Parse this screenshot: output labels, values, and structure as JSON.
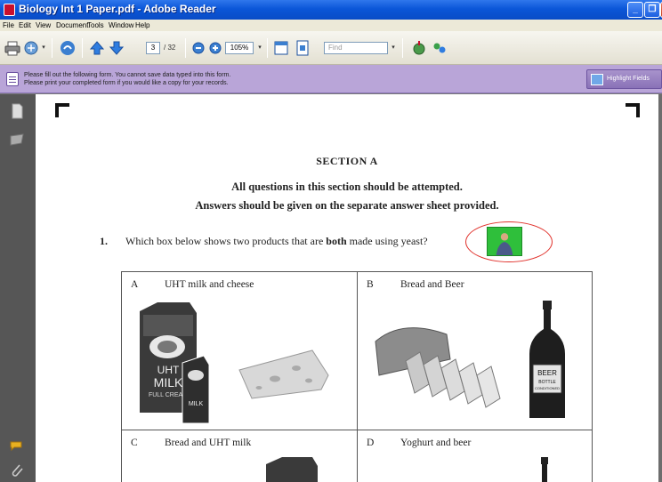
{
  "window": {
    "title": "Biology Int 1 Paper.pdf - Adobe Reader",
    "controls": [
      "minimize",
      "maximize",
      "close"
    ]
  },
  "menu": [
    "File",
    "Edit",
    "View",
    "Document",
    "Tools",
    "Window",
    "Help"
  ],
  "toolbar": {
    "current_page": "3",
    "total_pages": "/ 32",
    "zoom": "105%",
    "find_placeholder": "Find"
  },
  "form_bar": {
    "line1": "Please fill out the following form. You cannot save data typed into this form.",
    "line2": "Please print your completed form if you would like a copy for your records.",
    "highlight_button": "Highlight Fields"
  },
  "document": {
    "section": "SECTION A",
    "instruction1": "All questions in this section should be attempted.",
    "instruction2": "Answers should be given on the separate answer sheet provided.",
    "question_number": "1.",
    "question_before": "Which box below shows two products that are ",
    "question_bold": "both",
    "question_after": " made using yeast?",
    "options": [
      {
        "letter": "A",
        "text": "UHT milk and cheese"
      },
      {
        "letter": "B",
        "text": "Bread and Beer"
      },
      {
        "letter": "C",
        "text": "Bread and UHT milk"
      },
      {
        "letter": "D",
        "text": "Yoghurt and beer"
      }
    ],
    "milk_carton_text": [
      "UHT",
      "MILK",
      "FULL CREAM"
    ],
    "small_carton_text": "MILK",
    "beer_label": [
      "BEER",
      "BOTTLE",
      "CONDITIONED"
    ]
  },
  "colors": {
    "titlebar": "#0b56d8",
    "form_bar": "#b9a5d8",
    "annotation_circle": "#e0302a",
    "video_thumb": "#2fbf3b"
  }
}
